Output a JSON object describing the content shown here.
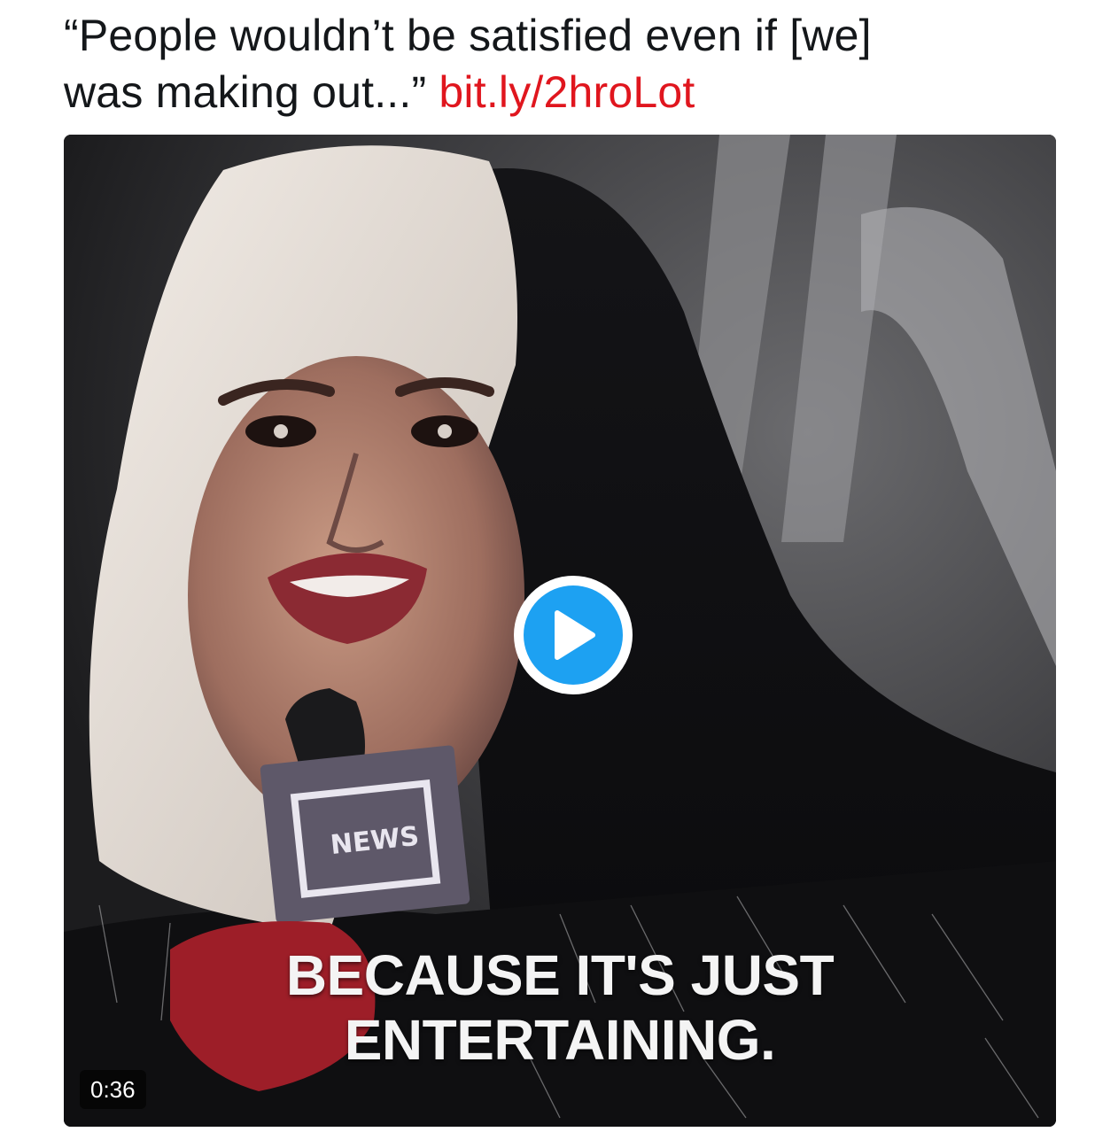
{
  "tweet": {
    "quote_line1": "“People wouldn’t be satisfied even if [we]",
    "quote_line2": "was making out...”",
    "link_text": "bit.ly/2hroLot"
  },
  "video": {
    "caption_line1": "BECAUSE IT'S JUST",
    "caption_line2": "ENTERTAINING.",
    "duration": "0:36",
    "mic_flag_text": "NEWS"
  },
  "colors": {
    "link": "#e0161e",
    "play_button": "#1da1f2",
    "text": "#14171a"
  },
  "icons": {
    "play": "play-icon"
  }
}
